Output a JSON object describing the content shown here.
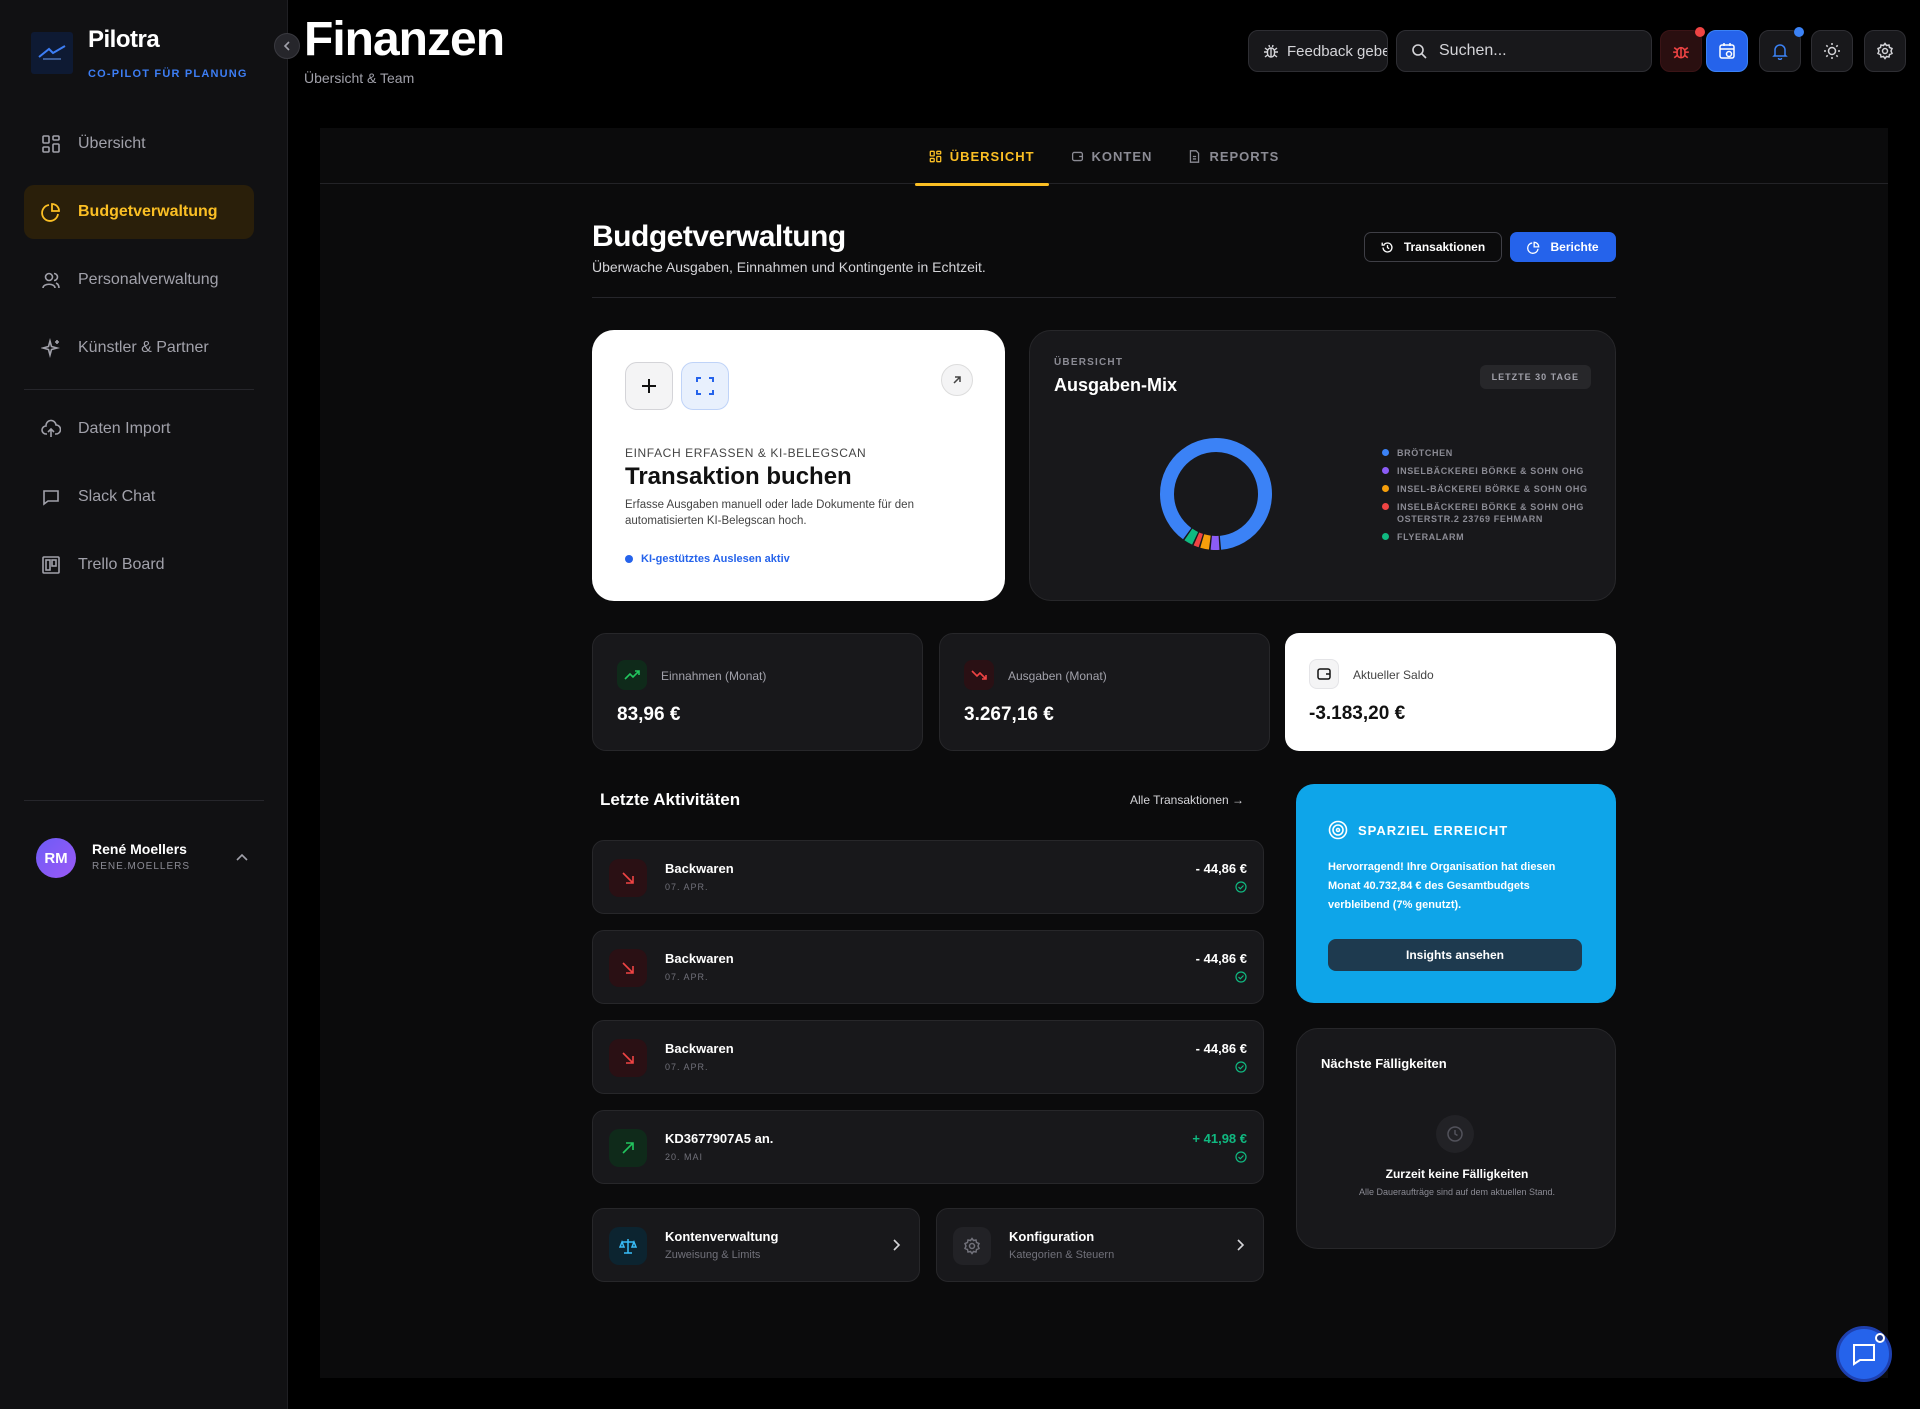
{
  "app": {
    "name": "Pilotra",
    "tagline": "CO-PILOT FÜR PLANUNG"
  },
  "sidebar": {
    "items": [
      {
        "label": "Übersicht",
        "icon": "grid-icon"
      },
      {
        "label": "Budgetverwaltung",
        "icon": "pie-chart-icon",
        "active": true
      },
      {
        "label": "Personalverwaltung",
        "icon": "users-icon"
      },
      {
        "label": "Künstler & Partner",
        "icon": "sparkles-icon"
      },
      {
        "label": "Daten Import",
        "icon": "cloud-upload-icon"
      },
      {
        "label": "Slack Chat",
        "icon": "chat-icon"
      },
      {
        "label": "Trello Board",
        "icon": "board-icon"
      }
    ],
    "user": {
      "initials": "RM",
      "name": "René Moellers",
      "handle": "RENE.MOELLERS"
    }
  },
  "header": {
    "title": "Finanzen",
    "subtitle": "Übersicht & Team",
    "feedback_label": "Feedback geben",
    "search_placeholder": "Suchen..."
  },
  "tabs": [
    {
      "label": "ÜBERSICHT",
      "active": true
    },
    {
      "label": "KONTEN"
    },
    {
      "label": "REPORTS"
    }
  ],
  "section": {
    "title": "Budgetverwaltung",
    "subtitle": "Überwache Ausgaben, Einnahmen und Kontingente in Echtzeit.",
    "btn_transactions": "Transaktionen",
    "btn_reports": "Berichte"
  },
  "booking_card": {
    "eyebrow": "EINFACH ERFASSEN & KI-BELEGSCAN",
    "title": "Transaktion buchen",
    "description": "Erfasse Ausgaben manuell oder lade Dokumente für den automatisierten KI-Belegscan hoch.",
    "ai_status": "KI-gestütztes Auslesen aktiv"
  },
  "mix_card": {
    "eyebrow": "ÜBERSICHT",
    "title": "Ausgaben-Mix",
    "badge": "LETZTE 30 TAGE",
    "legend": [
      {
        "label": "Brötchen",
        "color": "#3b82f6"
      },
      {
        "label": "Inselbäckerei Börke & Sohn OHG",
        "color": "#8b5cf6"
      },
      {
        "label": "Insel-Bäckerei Börke & Sohn OHG",
        "color": "#f59e0b"
      },
      {
        "label": "Inselbäckerei Börke & Sohn OHG Osterstr.2 23769 Fehmarn",
        "color": "#ef4444"
      },
      {
        "label": "Flyeralarm",
        "color": "#10b981"
      }
    ],
    "shares": [
      0.89,
      0.03,
      0.03,
      0.02,
      0.03
    ]
  },
  "stats": {
    "income": {
      "label": "Einnahmen (Monat)",
      "value": "83,96 €",
      "color": "#22c55e"
    },
    "expenses": {
      "label": "Ausgaben (Monat)",
      "value": "3.267,16 €",
      "color": "#ef4444"
    },
    "balance": {
      "label": "Aktueller Saldo",
      "value": "-3.183,20 €"
    }
  },
  "activities": {
    "title": "Letzte Aktivitäten",
    "link": "Alle Transaktionen →",
    "items": [
      {
        "name": "Backwaren",
        "date": "07. APR.",
        "amount": "- 44,86 €",
        "type": "out"
      },
      {
        "name": "Backwaren",
        "date": "07. APR.",
        "amount": "- 44,86 €",
        "type": "out"
      },
      {
        "name": "Backwaren",
        "date": "07. APR.",
        "amount": "- 44,86 €",
        "type": "out"
      },
      {
        "name": "KD3677907A5 an.",
        "date": "20. MAI",
        "amount": "+ 41,98 €",
        "type": "in"
      }
    ]
  },
  "quick": [
    {
      "title": "Kontenverwaltung",
      "subtitle": "Zuweisung & Limits",
      "icon": "scale-icon"
    },
    {
      "title": "Konfiguration",
      "subtitle": "Kategorien & Steuern",
      "icon": "gear-icon"
    }
  ],
  "savings": {
    "title": "SPARZIEL ERREICHT",
    "text": "Hervorragend! Ihre Organisation hat diesen Monat 40.732,84 € des Gesamtbudgets verbleibend (7% genutzt).",
    "button": "Insights ansehen"
  },
  "due": {
    "title": "Nächste Fälligkeiten",
    "empty": "Zurzeit keine Fälligkeiten",
    "sub": "Alle Daueraufträge sind auf dem aktuellen Stand."
  }
}
